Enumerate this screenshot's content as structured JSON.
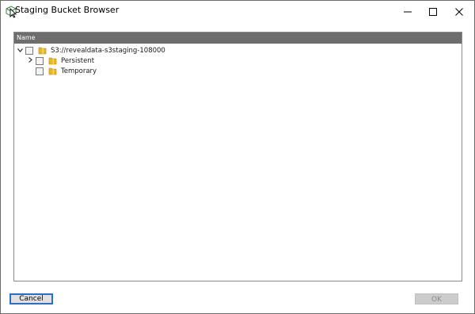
{
  "window": {
    "title": "Staging Bucket Browser",
    "minimize_icon": "minimize-icon",
    "maximize_icon": "maximize-icon",
    "close_icon": "close-icon"
  },
  "tree": {
    "column_header": "Name",
    "root": {
      "label": "S3://revealdata-s3staging-108000",
      "expanded": true,
      "checked": false,
      "children": [
        {
          "label": "Persistent",
          "expandable": true,
          "expanded": false,
          "checked": false
        },
        {
          "label": "Temporary",
          "expandable": false,
          "checked": false
        }
      ]
    }
  },
  "buttons": {
    "cancel_label": "Cancel",
    "ok_label": "OK",
    "ok_enabled": false
  },
  "colors": {
    "header_bg": "#6d6d6d",
    "folder": "#e8b52b",
    "focus_border": "#2a6fc9"
  }
}
